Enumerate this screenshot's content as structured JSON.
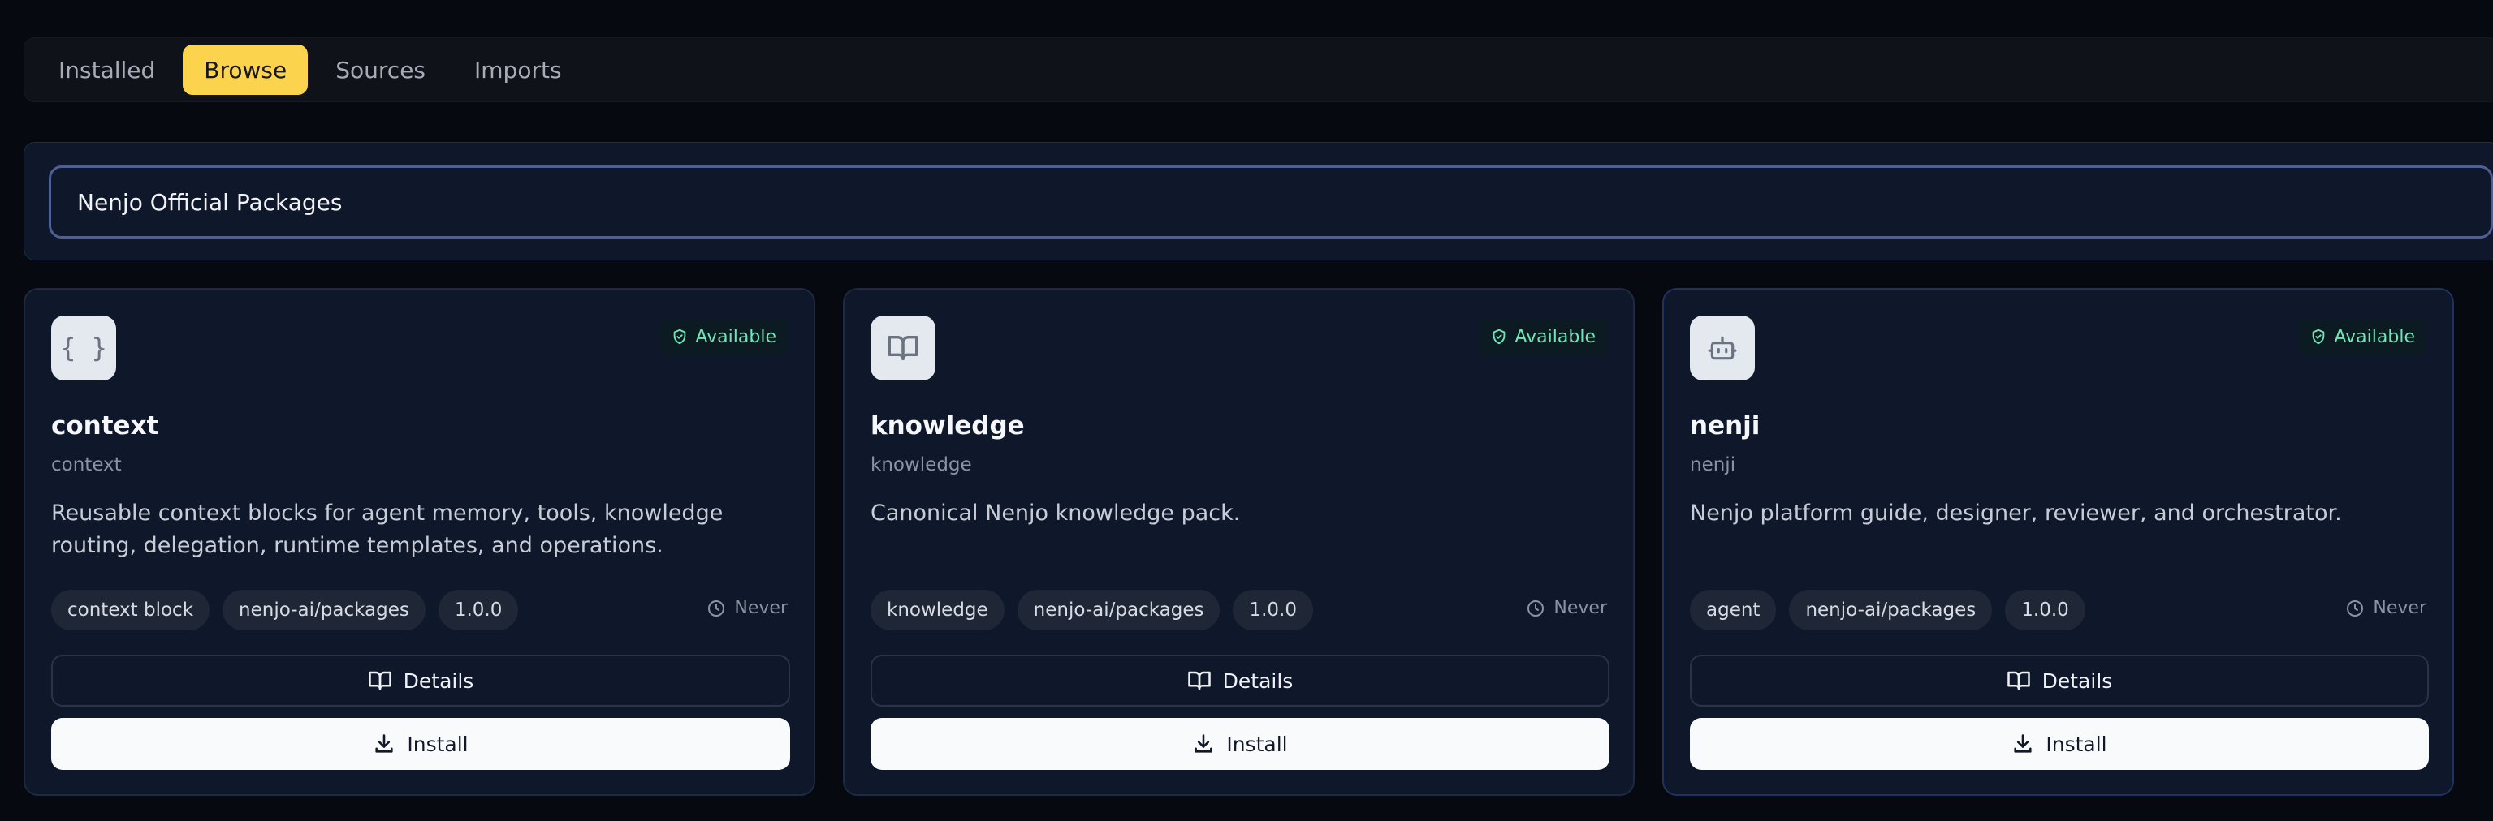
{
  "tabs": [
    {
      "label": "Installed"
    },
    {
      "label": "Browse",
      "active": true
    },
    {
      "label": "Sources"
    },
    {
      "label": "Imports"
    }
  ],
  "source_selector": {
    "value": "Nenjo Official Packages"
  },
  "colors": {
    "accent": "#fcd34d",
    "available": "#6ee7b7",
    "card_bg": "#0f172a",
    "page_bg": "#06090f"
  },
  "packages": [
    {
      "icon": "braces-icon",
      "icon_glyph": "{ }",
      "status": "Available",
      "title": "context",
      "subtitle": "context",
      "description": "Reusable context blocks for agent memory, tools, knowledge routing, delegation, runtime templates, and operations.",
      "tags": [
        "context block",
        "nenjo-ai/packages",
        "1.0.0"
      ],
      "last_updated": "Never",
      "details_label": "Details",
      "install_label": "Install"
    },
    {
      "icon": "book-icon",
      "status": "Available",
      "title": "knowledge",
      "subtitle": "knowledge",
      "description": "Canonical Nenjo knowledge pack.",
      "tags": [
        "knowledge",
        "nenjo-ai/packages",
        "1.0.0"
      ],
      "last_updated": "Never",
      "details_label": "Details",
      "install_label": "Install"
    },
    {
      "icon": "bot-icon",
      "status": "Available",
      "title": "nenji",
      "subtitle": "nenji",
      "description": "Nenjo platform guide, designer, reviewer, and orchestrator.",
      "tags": [
        "agent",
        "nenjo-ai/packages",
        "1.0.0"
      ],
      "last_updated": "Never",
      "details_label": "Details",
      "install_label": "Install"
    }
  ]
}
